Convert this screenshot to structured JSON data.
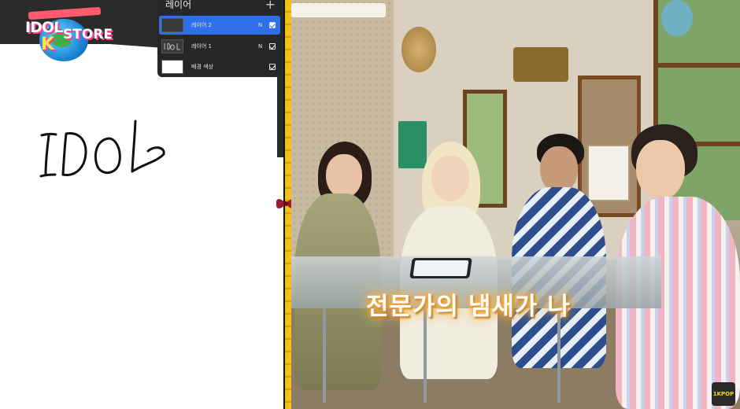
{
  "logo": {
    "line1": "IDOL",
    "line2": "K",
    "line3": "STORE"
  },
  "layers_panel": {
    "title": "레이어",
    "add_icon": "+",
    "layers": [
      {
        "name": "레이어 2",
        "blend": "N",
        "visible": true,
        "active": true
      },
      {
        "name": "레이어 1",
        "blend": "N",
        "visible": true,
        "active": false
      },
      {
        "name": "배경 색상",
        "blend": "",
        "visible": true,
        "active": false
      }
    ]
  },
  "canvas": {
    "handwriting": "IDOL"
  },
  "video": {
    "caption": "전문가의 냄새가 나",
    "watermark": "1KPOP"
  },
  "colors": {
    "divider": "#f2c21b",
    "active_layer": "#2f6fe8",
    "caption_glow": "#ffb13b"
  },
  "icons": [
    "plus-icon",
    "checkbox-icon",
    "bow-icon"
  ]
}
